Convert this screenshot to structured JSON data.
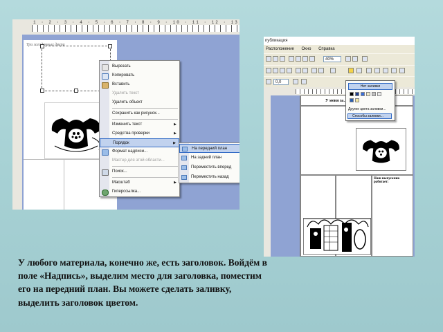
{
  "left_screenshot": {
    "ruler_numbers": "1 · 2 · 3 · 4 · 5 · 6 · 7 · 8 · 9 · 10 · 11 · 12 · 13",
    "doc_title": "Три загадочных двери",
    "context_menu": [
      {
        "label": "Вырезать",
        "icon": "scissors-icon",
        "enabled": true
      },
      {
        "label": "Копировать",
        "icon": "copy-icon",
        "enabled": true
      },
      {
        "label": "Вставить",
        "icon": "paste-icon",
        "enabled": true
      },
      {
        "label": "Удалить текст",
        "enabled": false
      },
      {
        "label": "Удалить объект",
        "enabled": true
      },
      {
        "label": "Сохранить как рисунок...",
        "enabled": true
      },
      {
        "label": "Изменить текст",
        "enabled": true,
        "submenu": true
      },
      {
        "label": "Средства проверки",
        "enabled": true,
        "submenu": true
      },
      {
        "label": "Порядок",
        "enabled": true,
        "submenu": true,
        "highlighted": true
      },
      {
        "label": "Формат надписи...",
        "icon": "format-icon",
        "enabled": true
      },
      {
        "label": "Мастер для этой области...",
        "enabled": false
      },
      {
        "label": "Поиск...",
        "icon": "find-icon",
        "enabled": true
      },
      {
        "label": "Масштаб",
        "enabled": true,
        "submenu": true
      },
      {
        "label": "Гиперссылка...",
        "icon": "hyperlink-icon",
        "enabled": true
      }
    ],
    "submenu": [
      {
        "label": "На передний план",
        "highlighted": true
      },
      {
        "label": "На задний план"
      },
      {
        "label": "Переместить вперед"
      },
      {
        "label": "Переместить назад"
      }
    ]
  },
  "right_screenshot": {
    "title": "публикация",
    "menu": [
      "Расположение",
      "Окно",
      "Справка"
    ],
    "zoom": "40%",
    "font_size": "0,0",
    "fill_dropdown": {
      "no_fill": "Нет заливки",
      "swatches": [
        "#000000",
        "#1f3f8f",
        "#3a6fd8",
        "#f0e9c6",
        "#c0c0c0",
        "#e8e8e8",
        "#2a5fb0",
        "#f4e7a3"
      ],
      "more_colors": "Другие цвета заливки...",
      "fill_effects": "Способы заливки..."
    },
    "doc_heading": "У меня за…",
    "doc_subheading": "Наш выпускник работает:"
  },
  "caption": "У любого материала, конечно же, есть заголовок. Войдём в поле «Надпись», выделим место для заголовка, поместим его на передний план. Вы можете сделать заливку, выделить заголовок цветом."
}
